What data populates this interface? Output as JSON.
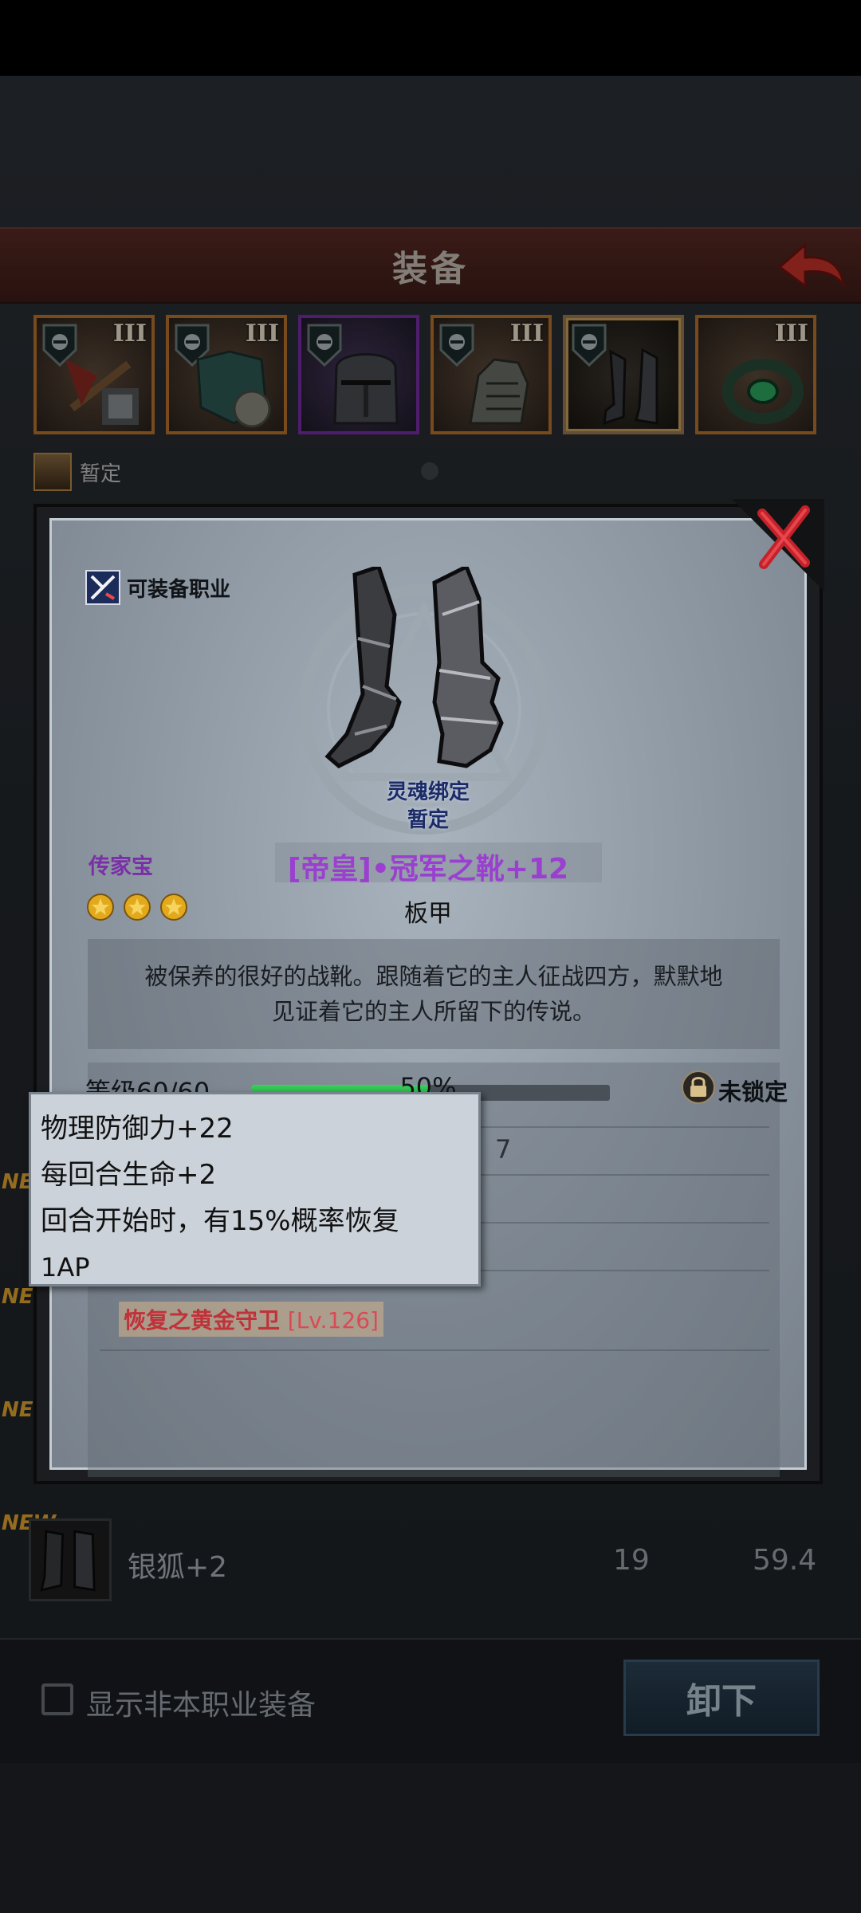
{
  "header": {
    "title": "装备"
  },
  "slots": [
    {
      "tier": "III",
      "rarity": "orange"
    },
    {
      "tier": "III",
      "rarity": "orange"
    },
    {
      "tier": "",
      "rarity": "purple"
    },
    {
      "tier": "III",
      "rarity": "orange"
    },
    {
      "tier": "",
      "rarity": "selected"
    },
    {
      "tier": "III",
      "rarity": "orange"
    }
  ],
  "temp_slot": {
    "label": "暂定"
  },
  "detail": {
    "job_label": "可装备职业",
    "soulbound": "灵魂绑定",
    "temporary": "暂定",
    "heirloom": "传家宝",
    "name": "[帝皇]•冠军之靴+12",
    "type": "板甲",
    "stars": 3,
    "description": [
      "被保养的很好的战靴。跟随着它的主人征战四方，默默地",
      "见证着它的主人所留下的传说。"
    ],
    "level_label": "等级60/60",
    "level_percent_text": "50%",
    "level_progress": 0.5,
    "lock_label": "未锁定",
    "faded_value": "7",
    "set_name": "恢复之黄金守卫",
    "set_level": "[Lv.126]"
  },
  "tooltip": {
    "lines": [
      "物理防御力+22",
      "每回合生命+2",
      "回合开始时，有15%概率恢复",
      "1AP"
    ]
  },
  "new_tags": {
    "label": "NEW"
  },
  "list_item": {
    "name": "银狐+2",
    "value1": "19",
    "value2": "59.4"
  },
  "bottom": {
    "checkbox_label": "显示非本职业装备",
    "unequip_label": "卸下"
  },
  "colors": {
    "accent_orange": "#b9722b",
    "accent_purple": "#7a2da8",
    "item_name": "#9a3fd0",
    "set_name": "#c0323a",
    "progress": "#2bbd4a"
  }
}
